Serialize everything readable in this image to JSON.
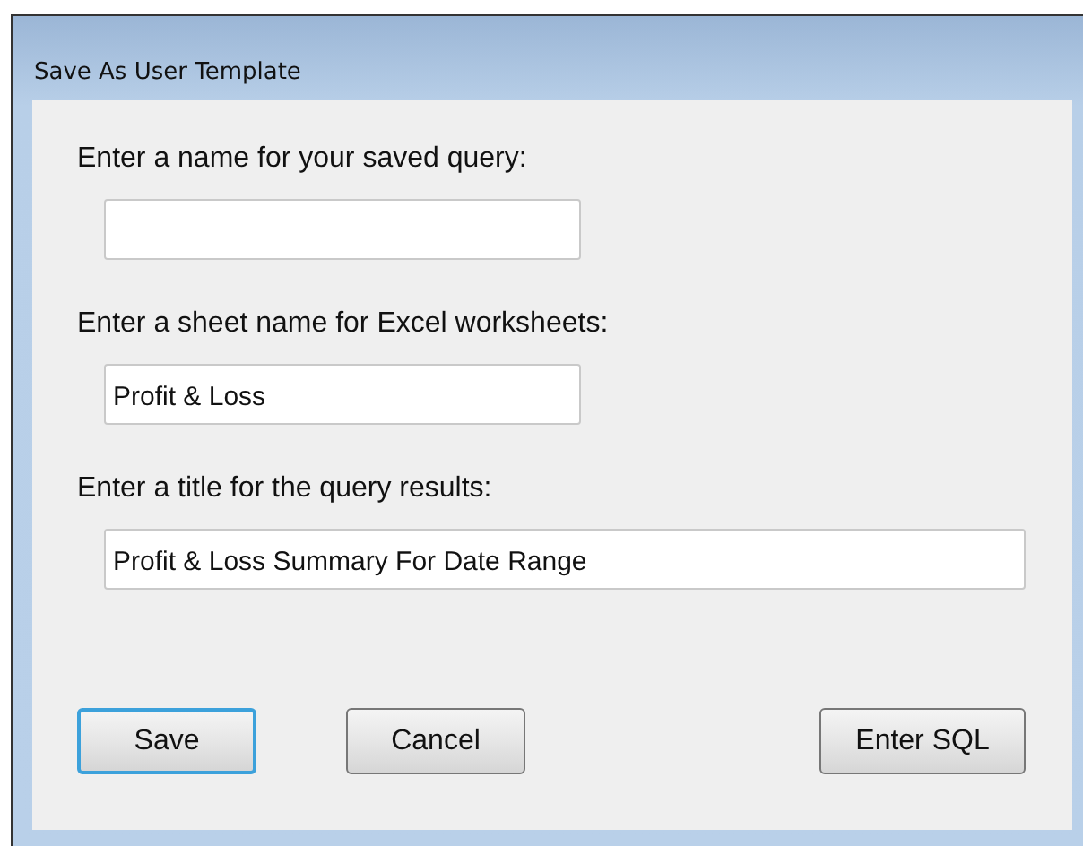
{
  "window": {
    "title": "Save As User Template"
  },
  "fields": [
    {
      "label": "Enter a name for your saved query:",
      "wide": false
    },
    {
      "label": "Enter a sheet name for Excel worksheets:",
      "value": "Profit & Loss",
      "wide": false
    },
    {
      "label": "Enter a title for the query results:",
      "value": "Profit & Loss Summary For Date Range",
      "wide": true
    }
  ],
  "buttons": [
    {
      "label": "Save",
      "default": true
    },
    {
      "label": "Cancel",
      "default": false
    },
    {
      "label": "Enter SQL",
      "default": false
    }
  ]
}
